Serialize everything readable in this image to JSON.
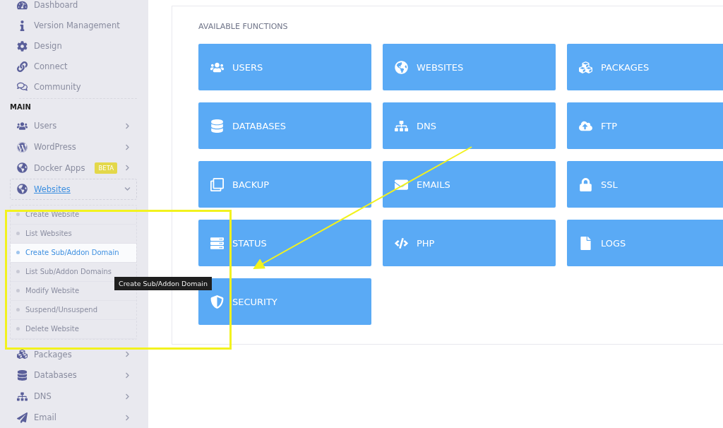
{
  "sidebar": {
    "top_items": [
      {
        "label": "Dashboard"
      },
      {
        "label": "Version Management"
      },
      {
        "label": "Design"
      },
      {
        "label": "Connect"
      },
      {
        "label": "Community"
      }
    ],
    "section_title": "MAIN",
    "main_items": [
      {
        "label": "Users",
        "selected": false,
        "expanded": false
      },
      {
        "label": "WordPress",
        "selected": false,
        "expanded": false
      },
      {
        "label": "Docker Apps",
        "badge": "BETA",
        "selected": false,
        "expanded": false
      },
      {
        "label": "Websites",
        "selected": true,
        "expanded": true,
        "children": [
          {
            "label": "Create Website",
            "selected": false
          },
          {
            "label": "List Websites",
            "selected": false
          },
          {
            "label": "Create Sub/Addon Domain",
            "selected": true
          },
          {
            "label": "List Sub/Addon Domains",
            "selected": false
          },
          {
            "label": "Modify Website",
            "selected": false
          },
          {
            "label": "Suspend/Unsuspend",
            "selected": false
          },
          {
            "label": "Delete Website",
            "selected": false
          }
        ]
      },
      {
        "label": "Packages",
        "selected": false,
        "expanded": false
      },
      {
        "label": "Databases",
        "selected": false,
        "expanded": false
      },
      {
        "label": "DNS",
        "selected": false,
        "expanded": false
      },
      {
        "label": "Email",
        "selected": false,
        "expanded": false
      }
    ]
  },
  "tooltip": "Create Sub/Addon Domain",
  "content": {
    "heading": "AVAILABLE FUNCTIONS",
    "tiles": [
      {
        "label": "USERS"
      },
      {
        "label": "WEBSITES"
      },
      {
        "label": "PACKAGES"
      },
      {
        "label": "DATABASES"
      },
      {
        "label": "DNS"
      },
      {
        "label": "FTP"
      },
      {
        "label": "BACKUP"
      },
      {
        "label": "EMAILS"
      },
      {
        "label": "SSL"
      },
      {
        "label": "STATUS"
      },
      {
        "label": "PHP"
      },
      {
        "label": "LOGS"
      },
      {
        "label": "SECURITY"
      }
    ]
  }
}
